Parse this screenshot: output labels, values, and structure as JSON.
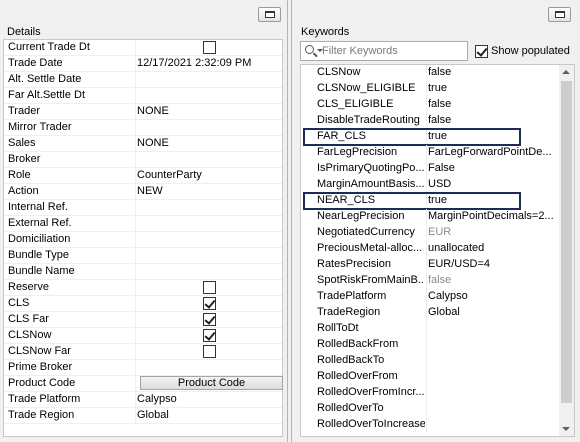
{
  "details": {
    "title": "Details",
    "rows": [
      {
        "label": "Current Trade Dt",
        "value": "",
        "checkbox": false
      },
      {
        "label": "Trade Date",
        "value": "12/17/2021 2:32:09 PM"
      },
      {
        "label": "Alt. Settle Date",
        "value": ""
      },
      {
        "label": "Far Alt.Settle Dt",
        "value": ""
      },
      {
        "label": "Trader",
        "value": "NONE"
      },
      {
        "label": "Mirror Trader",
        "value": ""
      },
      {
        "label": "Sales",
        "value": "NONE"
      },
      {
        "label": "Broker",
        "value": ""
      },
      {
        "label": "Role",
        "value": "CounterParty"
      },
      {
        "label": "Action",
        "value": "NEW"
      },
      {
        "label": "Internal Ref.",
        "value": ""
      },
      {
        "label": "External Ref.",
        "value": ""
      },
      {
        "label": "Domiciliation",
        "value": ""
      },
      {
        "label": "Bundle Type",
        "value": ""
      },
      {
        "label": "Bundle Name",
        "value": ""
      },
      {
        "label": "Reserve",
        "value": "",
        "checkbox": false
      },
      {
        "label": "CLS",
        "value": "",
        "checkbox": true
      },
      {
        "label": "CLS Far",
        "value": "",
        "checkbox": true
      },
      {
        "label": "CLSNow",
        "value": "",
        "checkbox": true
      },
      {
        "label": "CLSNow Far",
        "value": "",
        "checkbox": false
      },
      {
        "label": "Prime Broker",
        "value": ""
      },
      {
        "label": "Product Code",
        "value": "Product Code",
        "button": true
      },
      {
        "label": "Trade Platform",
        "value": "Calypso"
      },
      {
        "label": "Trade Region",
        "value": "Global"
      }
    ]
  },
  "keywords": {
    "title": "Keywords",
    "filter_placeholder": "Filter Keywords",
    "show_populated_label": "Show populated",
    "show_populated_checked": true,
    "rows": [
      {
        "key": "CLSNow",
        "value": "false"
      },
      {
        "key": "CLSNow_ELIGIBLE",
        "value": "true"
      },
      {
        "key": "CLS_ELIGIBLE",
        "value": "false"
      },
      {
        "key": "DisableTradeRouting",
        "value": "false"
      },
      {
        "key": "FAR_CLS",
        "value": "true",
        "highlighted": true
      },
      {
        "key": "FarLegPrecision",
        "value": "FarLegForwardPointDe..."
      },
      {
        "key": "IsPrimaryQuotingPo...",
        "value": "False"
      },
      {
        "key": "MarginAmountBasis...",
        "value": "USD"
      },
      {
        "key": "NEAR_CLS",
        "value": "true",
        "highlighted": true
      },
      {
        "key": "NearLegPrecision",
        "value": "MarginPointDecimals=2..."
      },
      {
        "key": "NegotiatedCurrency",
        "value": "EUR",
        "gray": true
      },
      {
        "key": "PreciousMetal-alloc...",
        "value": "unallocated"
      },
      {
        "key": "RatesPrecision",
        "value": "EUR/USD=4"
      },
      {
        "key": "SpotRiskFromMainB...",
        "value": "false",
        "gray": true
      },
      {
        "key": "TradePlatform",
        "value": "Calypso"
      },
      {
        "key": "TradeRegion",
        "value": "Global"
      },
      {
        "key": "RollToDt",
        "value": ""
      },
      {
        "key": "RolledBackFrom",
        "value": ""
      },
      {
        "key": "RolledBackTo",
        "value": ""
      },
      {
        "key": "RolledOverFrom",
        "value": ""
      },
      {
        "key": "RolledOverFromIncr...",
        "value": ""
      },
      {
        "key": "RolledOverTo",
        "value": ""
      },
      {
        "key": "RolledOverToIncrease",
        "value": ""
      }
    ]
  }
}
